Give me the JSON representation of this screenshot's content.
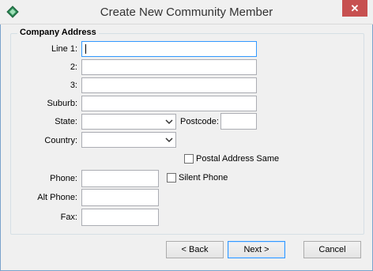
{
  "window": {
    "title": "Create New Community Member",
    "close_glyph": "✕"
  },
  "group": {
    "title": "Company Address",
    "fields": {
      "line1": {
        "label": "Line 1:",
        "value": ""
      },
      "line2": {
        "label": "2:",
        "value": ""
      },
      "line3": {
        "label": "3:",
        "value": ""
      },
      "suburb": {
        "label": "Suburb:",
        "value": ""
      },
      "state": {
        "label": "State:",
        "value": ""
      },
      "postcode": {
        "label": "Postcode:",
        "value": ""
      },
      "country": {
        "label": "Country:",
        "value": ""
      },
      "postal_same": {
        "label": "Postal Address Same",
        "checked": false
      },
      "phone": {
        "label": "Phone:",
        "value": ""
      },
      "silent_phone": {
        "label": "Silent Phone",
        "checked": false
      },
      "alt_phone": {
        "label": "Alt Phone:",
        "value": ""
      },
      "fax": {
        "label": "Fax:",
        "value": ""
      }
    }
  },
  "buttons": {
    "back": "< Back",
    "next": "Next >",
    "cancel": "Cancel"
  },
  "icons": {
    "app": "app-diamond-icon",
    "dropdown": "chevron-down-icon",
    "close": "close-icon"
  },
  "colors": {
    "close_button": "#c75050",
    "focus_border": "#3399ff"
  }
}
